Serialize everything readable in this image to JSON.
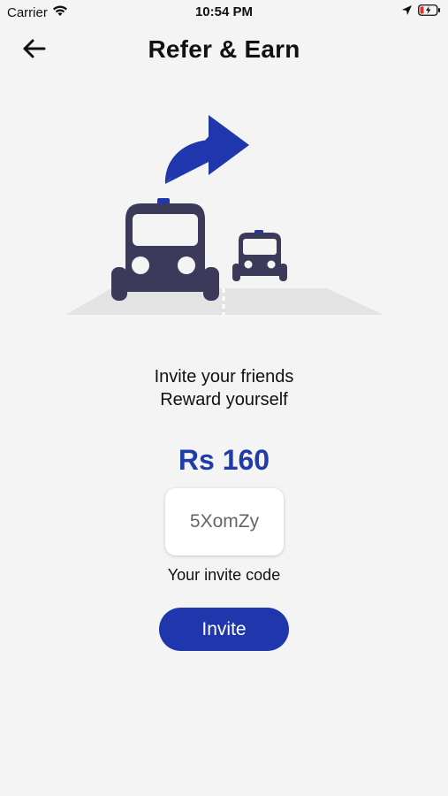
{
  "status_bar": {
    "carrier": "Carrier",
    "time": "10:54 PM",
    "icons": [
      "wifi-icon",
      "location-arrow-icon",
      "battery-charging-icon"
    ]
  },
  "nav": {
    "back_icon": "arrow-left-icon",
    "title": "Refer & Earn"
  },
  "illustration": {
    "description_icons": [
      "curved-arrow-icon",
      "car-large-icon",
      "car-small-icon",
      "road-icon"
    ],
    "colors": {
      "car": "#3b3a5a",
      "arrow": "#1f36ad",
      "road": "#e3e3e3"
    }
  },
  "content": {
    "invite_line1": "Invite your friends",
    "invite_line2": "Reward yourself",
    "amount": "Rs 160",
    "invite_code": "5XomZy",
    "code_caption": "Your invite code",
    "invite_button": "Invite"
  },
  "colors": {
    "accent": "#1f36ad",
    "amount": "#1f3ca8",
    "background": "#f4f4f4"
  }
}
